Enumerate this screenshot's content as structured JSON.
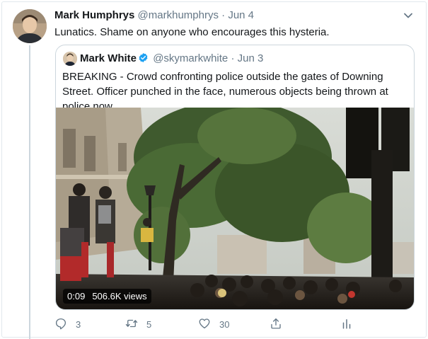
{
  "tweet": {
    "author_name": "Mark Humphrys",
    "author_handle": "@markhumphrys",
    "separator": "·",
    "date": "Jun 4",
    "text": "Lunatics. Shame on anyone who encourages this hysteria."
  },
  "quoted_tweet": {
    "author_name": "Mark White",
    "author_handle": "@skymarkwhite",
    "separator": "·",
    "date": "Jun 3",
    "verified": true,
    "text": "BREAKING - Crowd confronting police outside the gates of Downing Street. Officer punched in the face, numerous objects being thrown at police now.",
    "video": {
      "duration": "0:09",
      "views": "506.6K views"
    }
  },
  "actions": {
    "reply_count": "3",
    "retweet_count": "5",
    "like_count": "30"
  },
  "icons": {
    "more": "chevron-down-icon",
    "verified": "verified-badge-icon",
    "reply": "reply-icon",
    "retweet": "retweet-icon",
    "like": "heart-icon",
    "share": "share-icon",
    "analytics": "analytics-icon"
  },
  "colors": {
    "text_primary": "#14171a",
    "text_secondary": "#657786",
    "border": "#ccd6dd",
    "verified_blue": "#1da1f2"
  }
}
